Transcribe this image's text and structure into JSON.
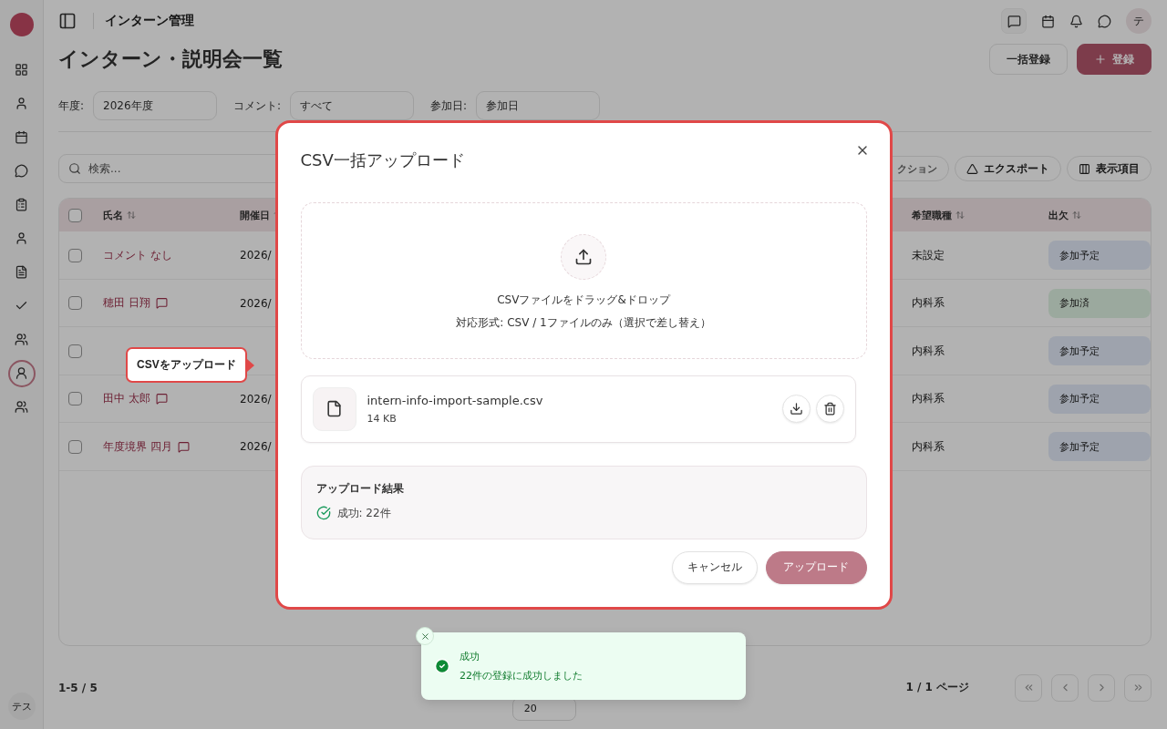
{
  "sidebar": {
    "items": [
      {
        "kind": "grid",
        "selected": false
      },
      {
        "kind": "user",
        "selected": false
      },
      {
        "kind": "calendar",
        "selected": false
      },
      {
        "kind": "chat",
        "selected": false
      },
      {
        "kind": "clipboard",
        "selected": false
      },
      {
        "kind": "user",
        "selected": false
      },
      {
        "kind": "file",
        "selected": false
      },
      {
        "kind": "check",
        "selected": false
      },
      {
        "kind": "users",
        "selected": false
      },
      {
        "kind": "intern",
        "selected": true
      },
      {
        "kind": "users",
        "selected": false
      }
    ],
    "avatar": "テス"
  },
  "header": {
    "title": "インターン管理",
    "avatar": "テ"
  },
  "page": {
    "title": "インターン・説明会一覧",
    "bulk_button": "一括登録",
    "add_button": "登録"
  },
  "filters": [
    {
      "label": "年度:",
      "value": "2026年度"
    },
    {
      "label": "コメント:",
      "value": "すべて"
    },
    {
      "label": "参加日:",
      "value": "参加日"
    }
  ],
  "toolbar": {
    "search_placeholder": "検索...",
    "buttons": [
      {
        "kind": "action",
        "label": "クション"
      },
      {
        "kind": "export",
        "label": "エクスポート"
      },
      {
        "kind": "columns",
        "label": "表示項目"
      }
    ]
  },
  "table": {
    "select_all_checked": false,
    "columns": [
      "氏名",
      "開催日",
      "希望職種",
      "出欠"
    ],
    "rows": [
      {
        "checked": false,
        "name": "コメント なし",
        "comment": false,
        "date": "2026/",
        "role": "未設定",
        "attendance": {
          "label": "参加予定",
          "kind": "planned"
        }
      },
      {
        "checked": false,
        "name": "穂田 日翔",
        "comment": true,
        "date": "2026/",
        "role": "内科系",
        "attendance": {
          "label": "参加済",
          "kind": "done"
        }
      },
      {
        "checked": false,
        "role": "内科系",
        "attendance": {
          "label": "参加予定",
          "kind": "planned"
        }
      },
      {
        "checked": false,
        "name": "田中 太郎",
        "comment": true,
        "date": "2026/",
        "role": "内科系",
        "attendance": {
          "label": "参加予定",
          "kind": "planned"
        }
      },
      {
        "checked": false,
        "name": "年度境界 四月",
        "comment": true,
        "date": "2026/",
        "role": "内科系",
        "attendance": {
          "label": "参加予定",
          "kind": "planned"
        }
      }
    ]
  },
  "footer": {
    "count": "1-5 / 5",
    "page_size": "20",
    "page": "1 / 1 ページ"
  },
  "modal": {
    "title": "CSV一括アップロード",
    "drop_title": "CSVファイルをドラッグ&ドロップ",
    "drop_hint": "対応形式: CSV / 1ファイルのみ（選択で差し替え）",
    "file": {
      "name": "intern-info-import-sample.csv",
      "size": "14 KB"
    },
    "result": {
      "title": "アップロード結果",
      "line": "成功: 22件"
    },
    "cancel_button": "キャンセル",
    "upload_button": "アップロード"
  },
  "tooltip": "CSVをアップロード",
  "toast": {
    "title": "成功",
    "message": "22件の登録に成功しました"
  }
}
